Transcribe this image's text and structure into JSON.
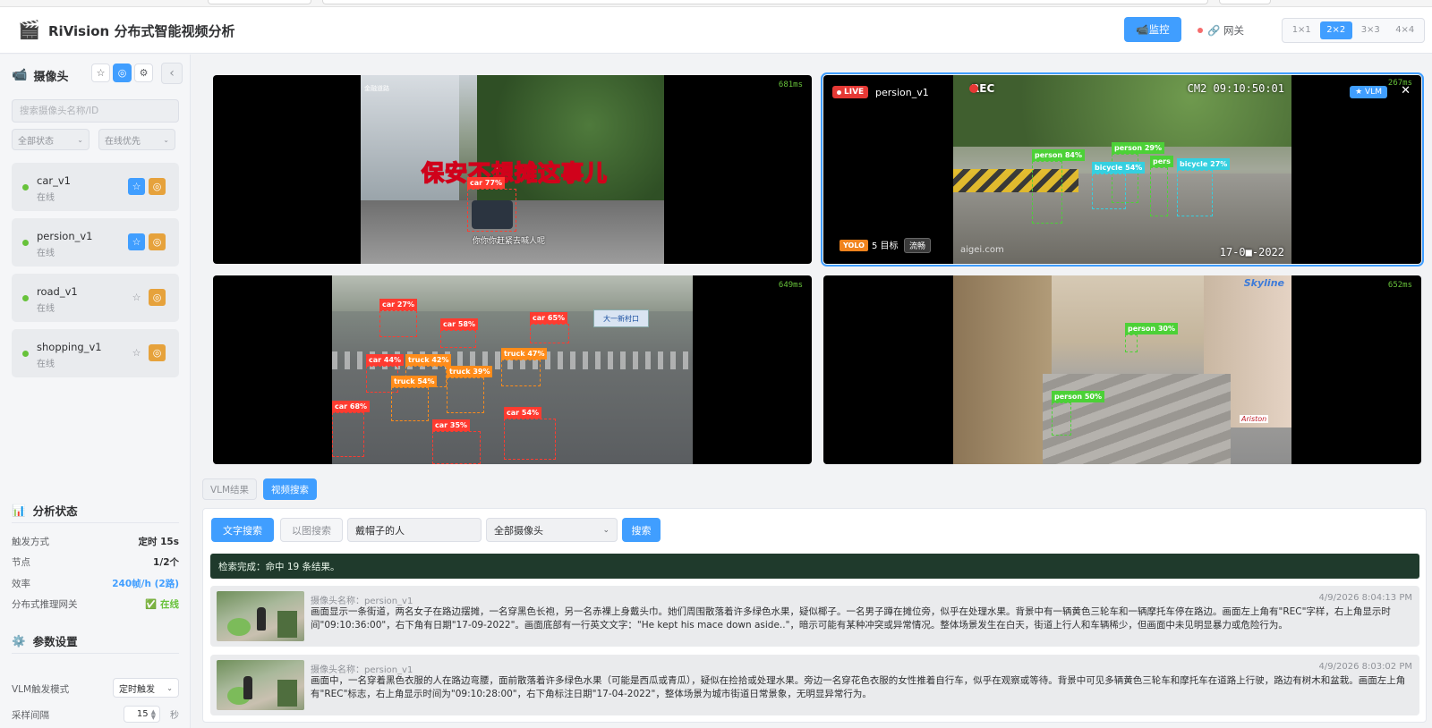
{
  "app": {
    "title": "RiVision 分布式智能视频分析",
    "logo_icon": "clapperboard-icon"
  },
  "header": {
    "monitor_label": "📹监控",
    "gateway_label": "🔗 网关",
    "layouts": [
      "1×1",
      "2×2",
      "3×3",
      "4×4"
    ],
    "active_layout": "2×2"
  },
  "sidebar": {
    "title": "摄像头",
    "search_placeholder": "搜索摄像头名称/ID",
    "filter_status": "全部状态",
    "filter_sort": "在线优先",
    "cameras": [
      {
        "name": "car_v1",
        "state": "在线",
        "favorite": true
      },
      {
        "name": "persion_v1",
        "state": "在线",
        "favorite": true
      },
      {
        "name": "road_v1",
        "state": "在线",
        "favorite": false
      },
      {
        "name": "shopping_v1",
        "state": "在线",
        "favorite": false
      }
    ],
    "analysis": {
      "title": "分析状态",
      "rows": [
        {
          "k": "触发方式",
          "v": "定时 15s"
        },
        {
          "k": "节点",
          "v": "1/2个"
        },
        {
          "k": "效率",
          "v": "240帧/h (2路)"
        },
        {
          "k": "分布式推理网关",
          "v": "✅ 在线"
        }
      ]
    },
    "params": {
      "title": "参数设置",
      "vlm_mode_label": "VLM触发模式",
      "vlm_mode_value": "定时触发",
      "interval_label": "采样间隔",
      "interval_value": "15",
      "interval_unit": "秒"
    }
  },
  "tiles": [
    {
      "latency": "681ms",
      "subtitle": "你你你赶紧去喊人呢",
      "caption": "保安不想摊这事儿",
      "watermark": "金融道路",
      "boxes": [
        {
          "label": "car 77%",
          "cls": "car"
        }
      ]
    },
    {
      "latency": "267ms",
      "live": "LIVE",
      "name": "persion_v1",
      "vlm": "★ VLM",
      "yolo": "YOLO",
      "targets": "5 目标",
      "stream": "流畅",
      "osd_tl": "REC",
      "osd_tr": "CM2 09:10:50:01",
      "osd_br": "17-0■-2022",
      "osd_bl": "aigei.com",
      "boxes": [
        {
          "label": "person 84%",
          "cls": "person"
        },
        {
          "label": "person 29%",
          "cls": "person"
        },
        {
          "label": "bicycle 54%",
          "cls": "bicycle"
        },
        {
          "label": "pers",
          "cls": "person"
        },
        {
          "label": "bicycle 27%",
          "cls": "bicycle"
        }
      ]
    },
    {
      "latency": "649ms",
      "sign": "大一新村口",
      "boxes": [
        {
          "label": "car 27%",
          "cls": "car"
        },
        {
          "label": "car 58%",
          "cls": "car"
        },
        {
          "label": "car 65%",
          "cls": "car"
        },
        {
          "label": "car 44%",
          "cls": "car"
        },
        {
          "label": "truck 42%",
          "cls": "truck"
        },
        {
          "label": "truck 47%",
          "cls": "truck"
        },
        {
          "label": "truck 39%",
          "cls": "truck"
        },
        {
          "label": "truck 54%",
          "cls": "truck"
        },
        {
          "label": "car 68%",
          "cls": "car"
        },
        {
          "label": "car 54%",
          "cls": "car"
        },
        {
          "label": "car 35%",
          "cls": "car"
        }
      ]
    },
    {
      "latency": "652ms",
      "logo": "Skyline",
      "store": "Ariston",
      "boxes": [
        {
          "label": "person 30%",
          "cls": "person"
        },
        {
          "label": "person 50%",
          "cls": "person"
        }
      ]
    }
  ],
  "bottom": {
    "tab_vlm": "VLM结果",
    "tab_search": "视频搜索",
    "btn_text_search": "文字搜索",
    "btn_image_search": "以图搜索",
    "query_value": "戴帽子的人",
    "camera_select": "全部摄像头",
    "search_btn": "搜索",
    "result_banner": "检索完成：命中 19 条结果。",
    "results": [
      {
        "cam": "摄像头名称：persion_v1",
        "time": "4/9/2026 8:04:13 PM",
        "text": "画面显示一条街道，两名女子在路边摆摊，一名穿黑色长袍，另一名赤裸上身戴头巾。她们周围散落着许多绿色水果，疑似椰子。一名男子蹲在摊位旁，似乎在处理水果。背景中有一辆黄色三轮车和一辆摩托车停在路边。画面左上角有\"REC\"字样，右上角显示时间\"09:10:36:00\"，右下角有日期\"17-09-2022\"。画面底部有一行英文文字：\"He kept his mace down aside..\"，暗示可能有某种冲突或异常情况。整体场景发生在白天，街道上行人和车辆稀少，但画面中未见明显暴力或危险行为。"
      },
      {
        "cam": "摄像头名称：persion_v1",
        "time": "4/9/2026 8:03:02 PM",
        "text": "画面中，一名穿着黑色衣服的人在路边弯腰，面前散落着许多绿色水果（可能是西瓜或青瓜），疑似在捡拾或处理水果。旁边一名穿花色衣服的女性推着自行车，似乎在观察或等待。背景中可见多辆黄色三轮车和摩托车在道路上行驶，路边有树木和盆栽。画面左上角有\"REC\"标志，右上角显示时间为\"09:10:28:00\"，右下角标注日期\"17-04-2022\"，整体场景为城市街道日常景象，无明显异常行为。"
      }
    ]
  }
}
